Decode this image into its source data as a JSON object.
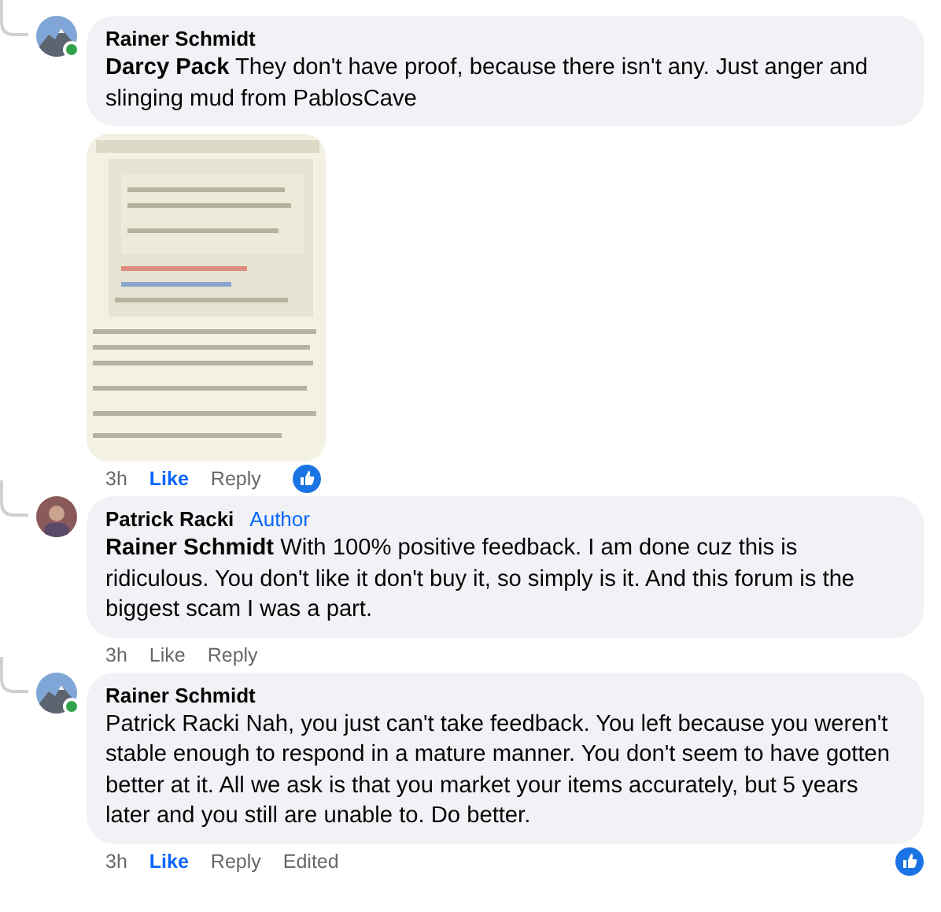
{
  "comments": [
    {
      "author": "Rainer Schmidt",
      "online": true,
      "mention": "Darcy Pack",
      "text": "They don't have proof, because there isn't any. Just anger and slinging mud from PablosCave",
      "time": "3h",
      "like": "Like",
      "liked": true,
      "reply": "Reply",
      "reaction": true
    },
    {
      "author": "Patrick Racki",
      "online": false,
      "badge": "Author",
      "mention": "Rainer Schmidt",
      "text": "With 100% positive feedback. I am done cuz this is ridiculous. You don't like it don't buy it, so simply is it. And this forum is the biggest scam I was a part.",
      "time": "3h",
      "like": "Like",
      "liked": false,
      "reply": "Reply",
      "reaction": false
    },
    {
      "author": "Rainer Schmidt",
      "online": true,
      "text": "Patrick Racki Nah, you just can't take feedback. You left because you weren't stable enough to respond in a mature manner. You don't seem to have gotten better at it. All we ask is that you market your items accurately, but 5 years later and you still are unable to. Do better.",
      "time": "3h",
      "like": "Like",
      "liked": true,
      "reply": "Reply",
      "edited": "Edited",
      "reaction": true
    }
  ]
}
